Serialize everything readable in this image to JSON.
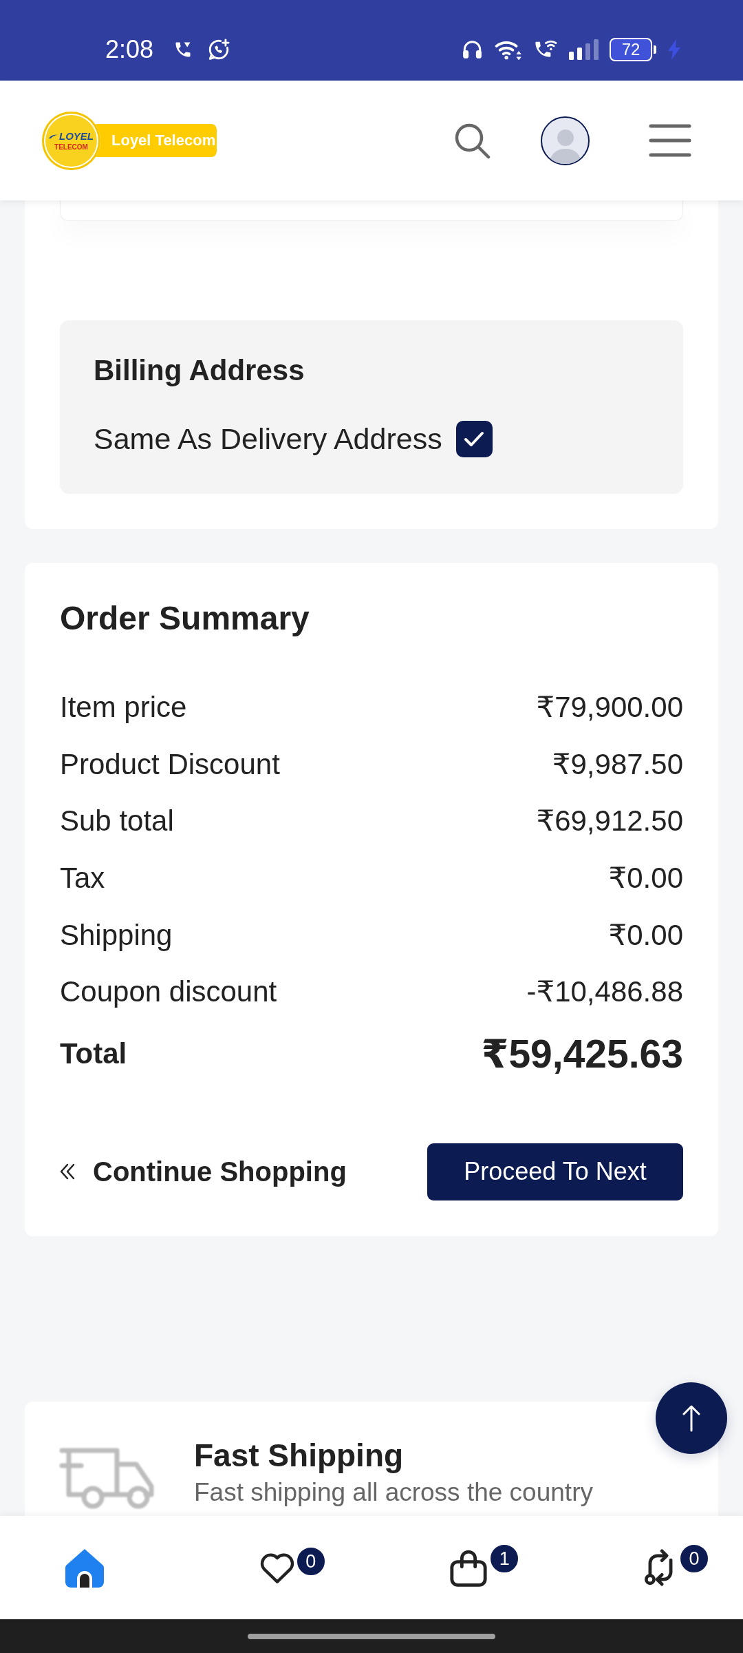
{
  "status_bar": {
    "time": "2:08",
    "battery": "72"
  },
  "header": {
    "logo": {
      "emblem_top": "LOYEL",
      "emblem_bottom": "TELECOM",
      "name": "Loyel Telecom"
    }
  },
  "billing_address": {
    "title": "Billing Address",
    "same_as_delivery": {
      "label": "Same As Delivery Address",
      "checked": true
    }
  },
  "order_summary": {
    "title": "Order Summary",
    "rows": [
      {
        "label": "Item price",
        "value": "₹79,900.00"
      },
      {
        "label": "Product Discount",
        "value": "₹9,987.50"
      },
      {
        "label": "Sub total",
        "value": "₹69,912.50"
      },
      {
        "label": "Tax",
        "value": "₹0.00"
      },
      {
        "label": "Shipping",
        "value": "₹0.00"
      },
      {
        "label": "Coupon discount",
        "value": "-₹10,486.88"
      }
    ],
    "total": {
      "label": "Total",
      "value": "₹59,425.63"
    },
    "continue_shopping": "Continue Shopping",
    "proceed_button": "Proceed To Next"
  },
  "features": [
    {
      "title": "Fast Shipping",
      "description": "Fast shipping all across the country"
    }
  ],
  "bottom_nav": [
    {
      "kind": "home",
      "selected": true
    },
    {
      "kind": "wishlist",
      "badge": "0",
      "selected": false
    },
    {
      "kind": "cart",
      "badge": "1",
      "selected": false
    },
    {
      "kind": "compare",
      "badge": "0",
      "selected": false
    }
  ]
}
